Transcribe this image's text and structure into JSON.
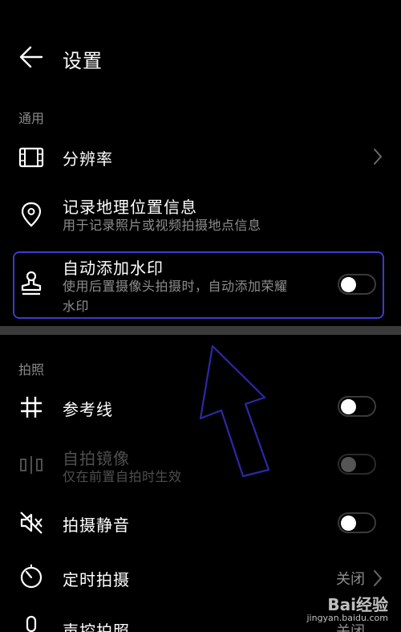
{
  "header": {
    "title": "设置"
  },
  "sections": {
    "general": "通用",
    "photo": "拍照"
  },
  "rows": {
    "resolution": {
      "title": "分辨率"
    },
    "location": {
      "title": "记录地理位置信息",
      "subtitle": "用于记录照片或视频拍摄地点信息"
    },
    "watermark": {
      "title": "自动添加水印",
      "subtitle_line1": "使用后置摄像头拍摄时，自动添加荣耀",
      "subtitle_line2": "水印"
    },
    "gridlines": {
      "title": "参考线"
    },
    "mirror": {
      "title": "自拍镜像",
      "subtitle": "仅在前置自拍时生效"
    },
    "mute": {
      "title": "拍摄静音"
    },
    "timer": {
      "title": "定时拍摄",
      "value": "关闭"
    },
    "voice": {
      "title": "声控拍照",
      "value": "关闭"
    }
  },
  "watermark_logo": {
    "text": "Bai经验",
    "url": "jingyan.baidu.com"
  },
  "colors": {
    "highlight": "#3b3bd0",
    "arrow": "#2a2aa8"
  }
}
